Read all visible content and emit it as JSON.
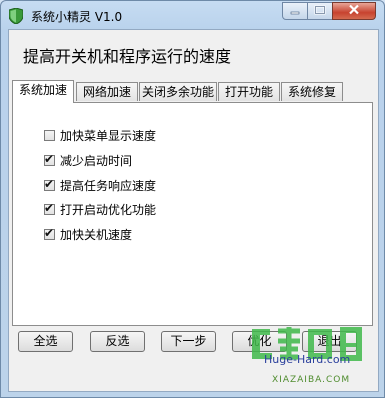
{
  "window": {
    "title": "系统小精灵 V1.0",
    "header": "提高开关机和程序运行的速度"
  },
  "tabs": [
    {
      "label": "系统加速",
      "active": true
    },
    {
      "label": "网络加速",
      "active": false
    },
    {
      "label": "关闭多余功能",
      "active": false
    },
    {
      "label": "打开功能",
      "active": false
    },
    {
      "label": "系统修复",
      "active": false
    }
  ],
  "options": [
    {
      "label": "加快菜单显示速度",
      "checked": false
    },
    {
      "label": "减少启动时间",
      "checked": true
    },
    {
      "label": "提高任务响应速度",
      "checked": true
    },
    {
      "label": "打开启动优化功能",
      "checked": true
    },
    {
      "label": "加快关机速度",
      "checked": true
    }
  ],
  "buttons": {
    "select_all": "全选",
    "invert": "反选",
    "next": "下一步",
    "optimize": "优化",
    "exit": "退出"
  },
  "watermark": {
    "url": "Huge-Hard.com",
    "sub": "XIAZAIBA.COM"
  },
  "icons": {
    "app": "shield-icon",
    "minimize": "minimize-icon",
    "maximize": "maximize-icon",
    "close": "close-icon",
    "checkbox_checked": "checkmark-icon"
  },
  "colors": {
    "frame": "#c6dcf2",
    "close_button": "#c7432f",
    "app_icon": "#3a9a3a",
    "watermark_green": "#4f8c2e"
  }
}
